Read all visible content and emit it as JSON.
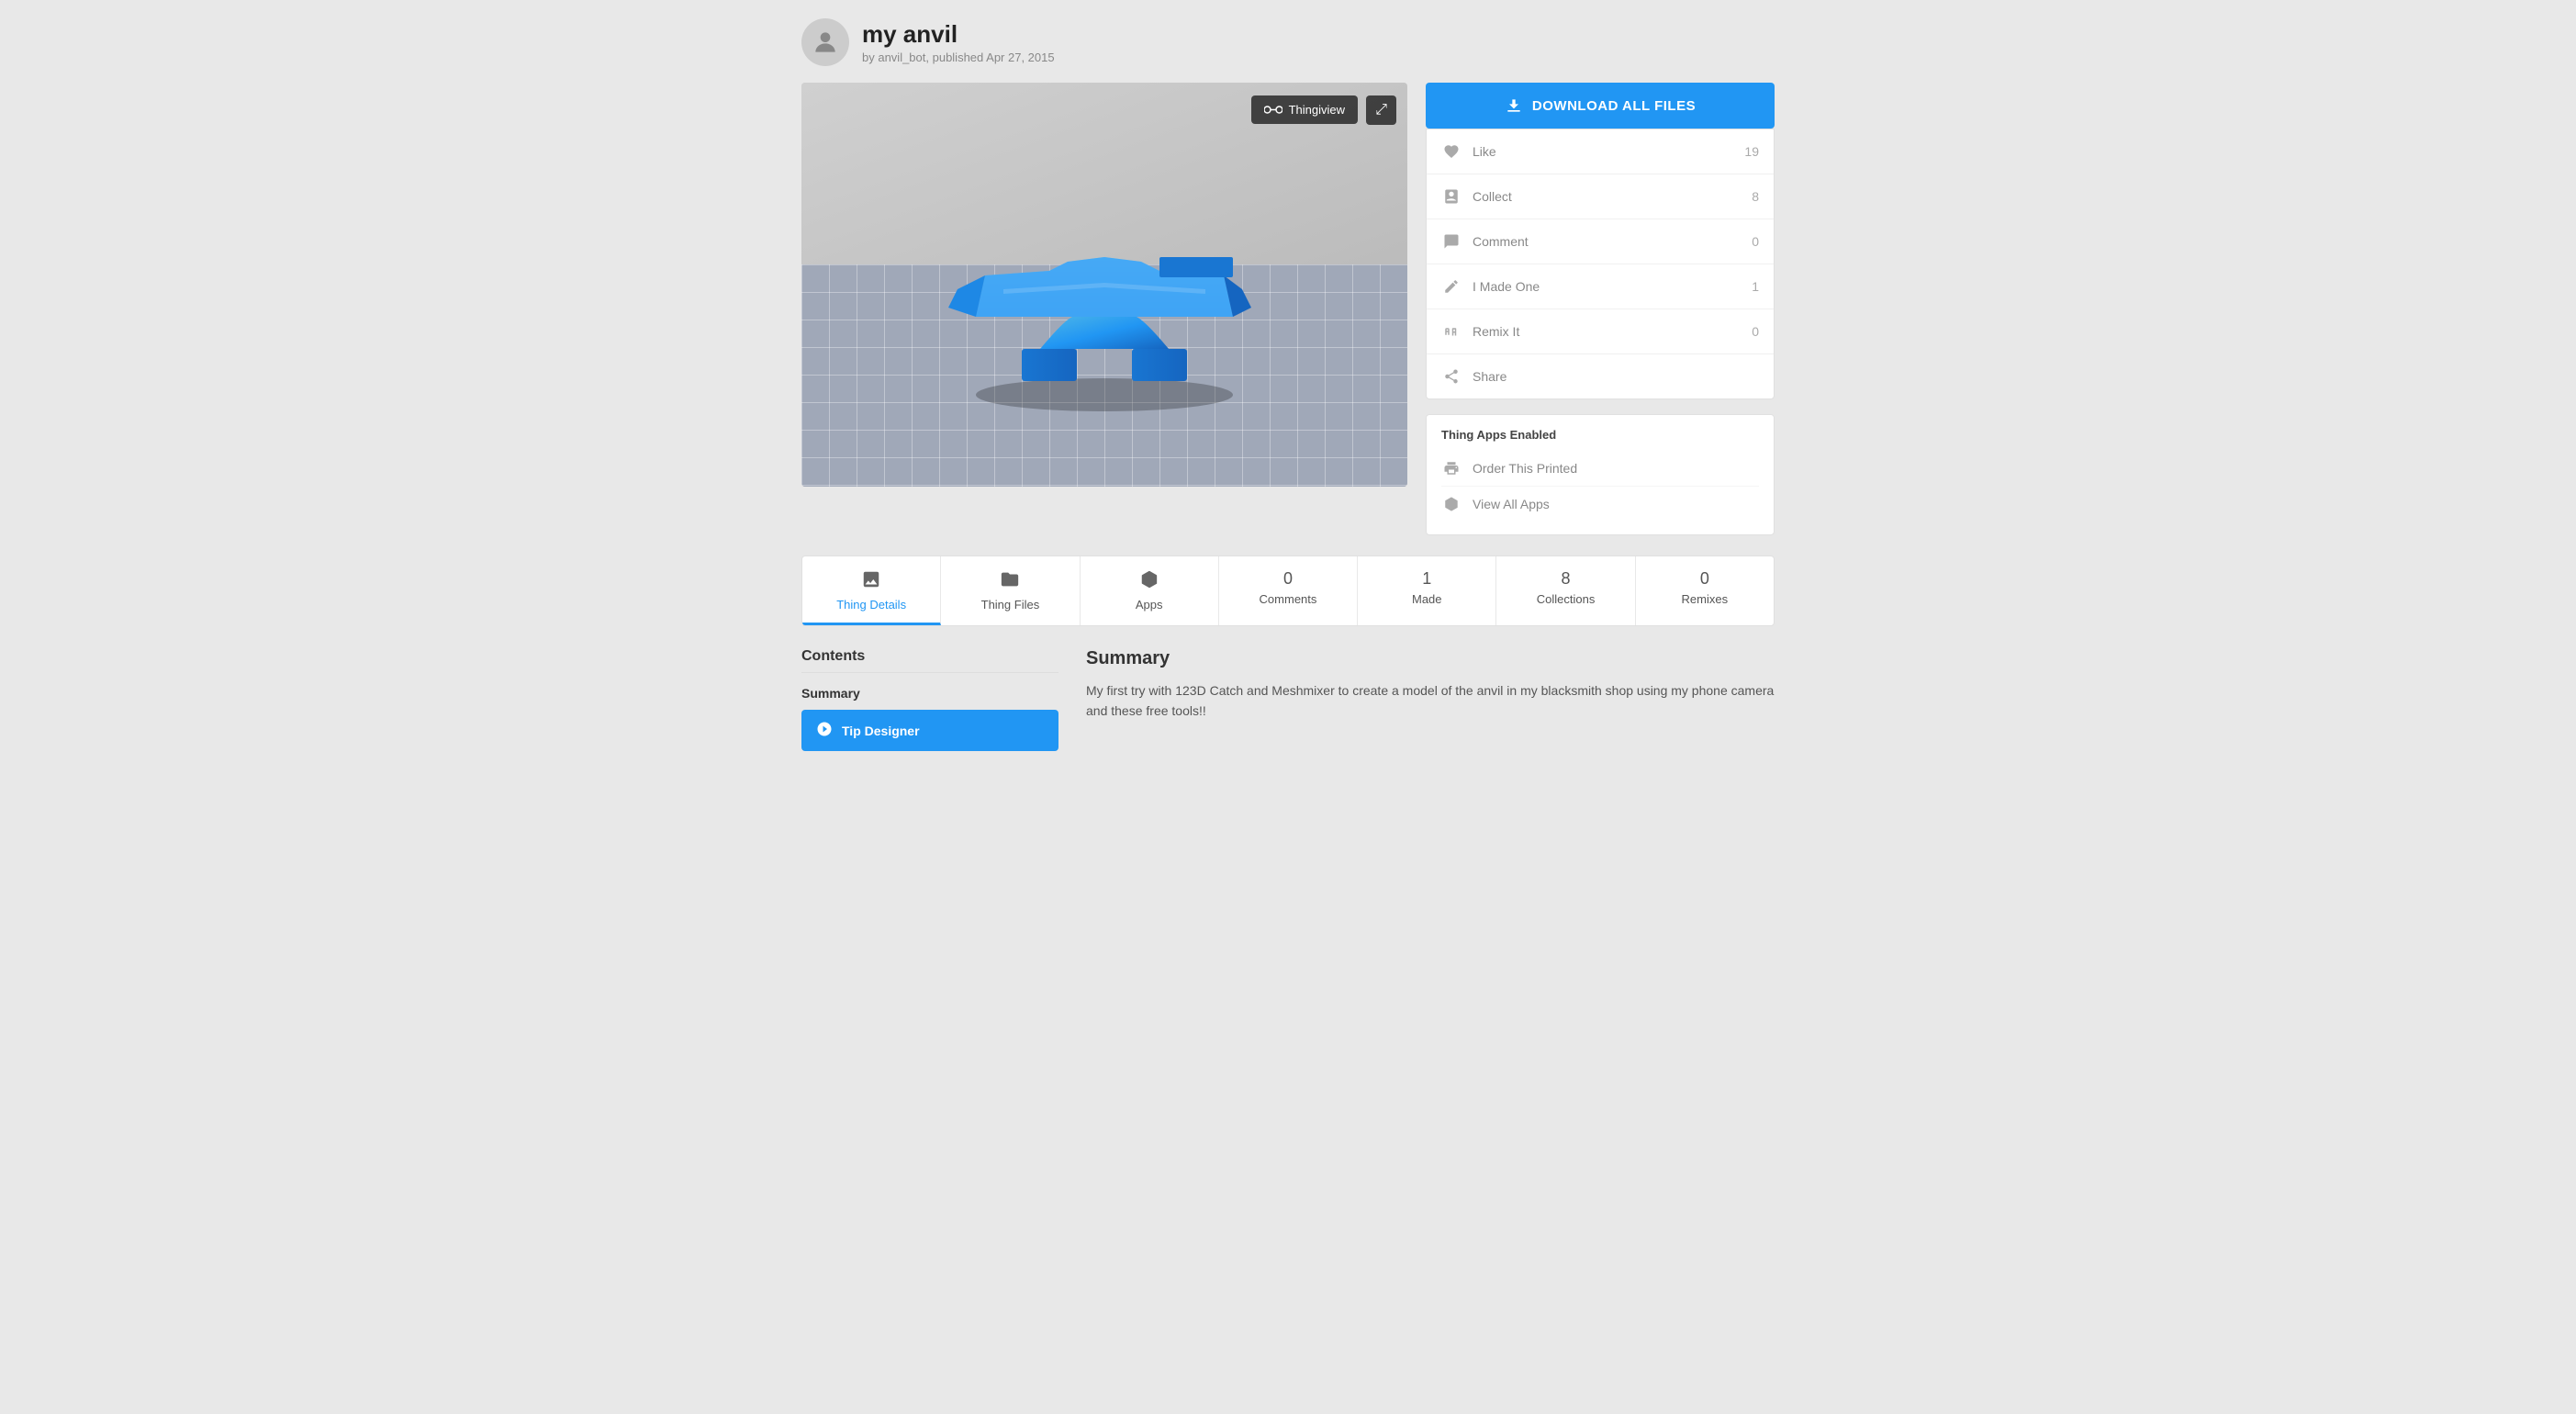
{
  "header": {
    "title": "my anvil",
    "meta": "by anvil_bot, published Apr 27, 2015"
  },
  "image": {
    "thingiview_label": "Thingiview"
  },
  "sidebar": {
    "download_btn": "DOWNLOAD ALL FILES",
    "actions": [
      {
        "icon": "heart-icon",
        "label": "Like",
        "count": "19"
      },
      {
        "icon": "collect-icon",
        "label": "Collect",
        "count": "8"
      },
      {
        "icon": "comment-icon",
        "label": "Comment",
        "count": "0"
      },
      {
        "icon": "made-icon",
        "label": "I Made One",
        "count": "1"
      },
      {
        "icon": "remix-icon",
        "label": "Remix It",
        "count": "0"
      },
      {
        "icon": "share-icon",
        "label": "Share",
        "count": ""
      }
    ],
    "apps_section_title": "Thing Apps Enabled",
    "apps": [
      {
        "icon": "print-icon",
        "label": "Order This Printed"
      },
      {
        "icon": "cube-icon",
        "label": "View All Apps"
      }
    ]
  },
  "tabs": [
    {
      "id": "thing-details",
      "icon": "image-icon",
      "label": "Thing Details",
      "count": null,
      "active": true
    },
    {
      "id": "thing-files",
      "icon": "file-icon",
      "label": "Thing Files",
      "count": null,
      "active": false
    },
    {
      "id": "apps",
      "icon": "cube-icon",
      "label": "Apps",
      "count": null,
      "active": false
    },
    {
      "id": "comments",
      "icon": null,
      "label": "Comments",
      "count": "0",
      "active": false
    },
    {
      "id": "made",
      "icon": null,
      "label": "Made",
      "count": "1",
      "active": false
    },
    {
      "id": "collections",
      "icon": null,
      "label": "Collections",
      "count": "8",
      "active": false
    },
    {
      "id": "remixes",
      "icon": null,
      "label": "Remixes",
      "count": "0",
      "active": false
    }
  ],
  "contents": {
    "title": "Contents",
    "section_label": "Summary",
    "tip_btn_label": "Tip Designer"
  },
  "summary": {
    "title": "Summary",
    "text": "My first try with 123D Catch and Meshmixer to create a model of the anvil in my blacksmith shop using my phone camera and these free tools!!"
  }
}
